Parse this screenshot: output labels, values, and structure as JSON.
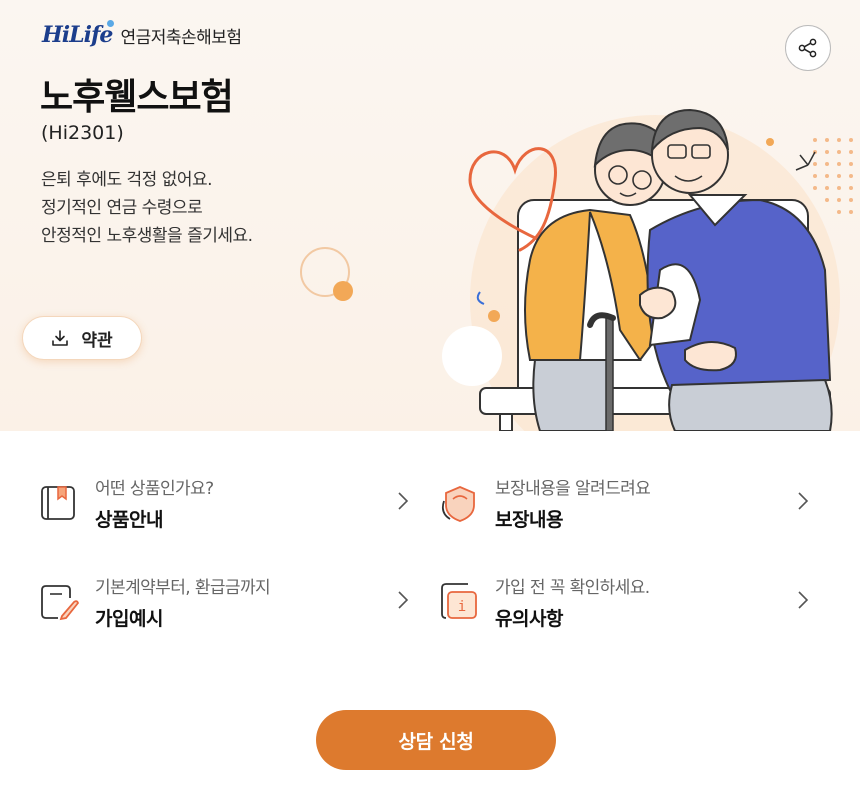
{
  "header": {
    "logo_text": "HiLife",
    "company": "연금저축손해보험",
    "share_icon": "share-icon"
  },
  "product": {
    "title": "노후웰스보험",
    "code": "(Hi2301)",
    "description": [
      "은퇴 후에도 걱정 없어요.",
      "정기적인 연금 수령으로",
      "안정적인 노후생활을 즐기세요."
    ],
    "terms_button": "약관"
  },
  "menu": [
    {
      "sub": "어떤 상품인가요?",
      "main": "상품안내",
      "icon": "bookmark-book-icon"
    },
    {
      "sub": "보장내용을 알려드려요",
      "main": "보장내용",
      "icon": "shield-icon"
    },
    {
      "sub": "기본계약부터, 환급금까지",
      "main": "가입예시",
      "icon": "document-pen-icon"
    },
    {
      "sub": "가입 전 꼭 확인하세요.",
      "main": "유의사항",
      "icon": "info-document-icon"
    }
  ],
  "cta": {
    "label": "상담 신청"
  },
  "colors": {
    "accent": "#dd7a2e",
    "brand_blue": "#1c3e8c",
    "hero_bg": "#fbf3ea"
  }
}
